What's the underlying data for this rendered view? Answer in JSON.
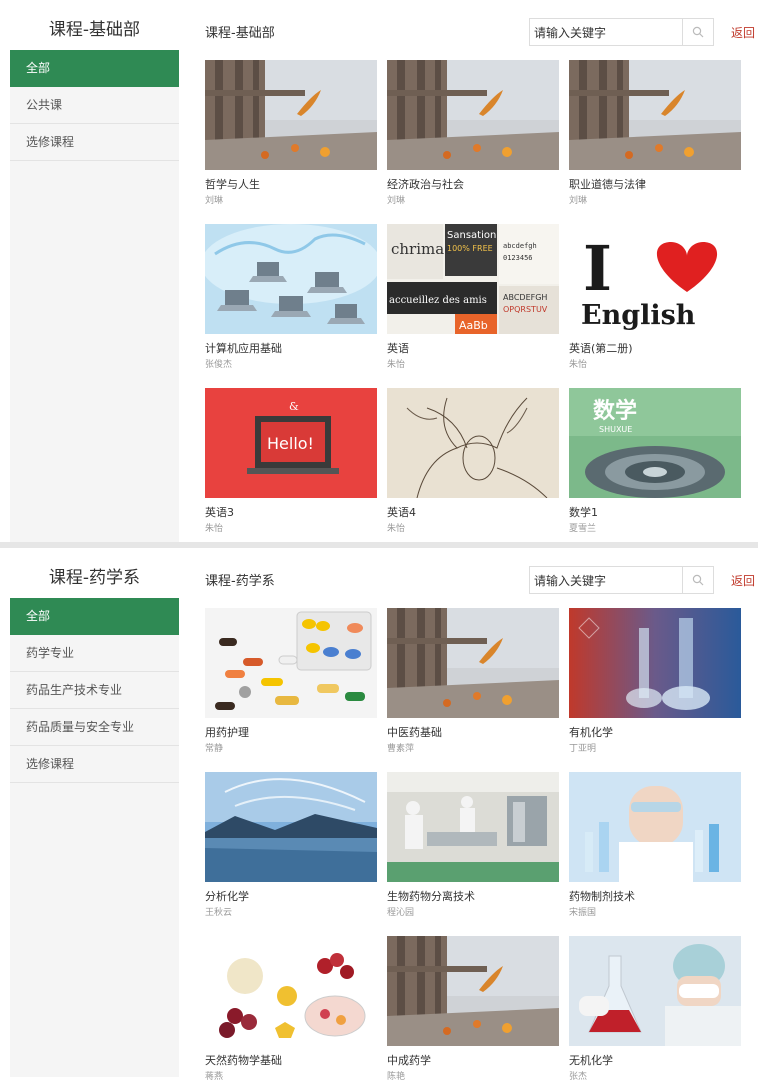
{
  "search_placeholder": "请输入关键字",
  "back_label": "返回",
  "panels": [
    {
      "title": "课程-基础部",
      "crumb": "课程-基础部",
      "menu": [
        "全部",
        "公共课",
        "选修课程"
      ],
      "courses": [
        {
          "title": "哲学与人生",
          "teacher": "刘琳",
          "image": "autumn-leaf-railing"
        },
        {
          "title": "经济政治与社会",
          "teacher": "刘琳",
          "image": "autumn-leaf-railing"
        },
        {
          "title": "职业道德与法律",
          "teacher": "刘琳",
          "image": "autumn-leaf-railing"
        },
        {
          "title": "计算机应用基础",
          "teacher": "张俊杰",
          "image": "network-laptops"
        },
        {
          "title": "英语",
          "teacher": "朱怡",
          "image": "typography-collage"
        },
        {
          "title": "英语(第二册)",
          "teacher": "朱怡",
          "image": "i-love-english"
        },
        {
          "title": "英语3",
          "teacher": "朱怡",
          "image": "hello-laptop"
        },
        {
          "title": "英语4",
          "teacher": "朱怡",
          "image": "deer-sketch"
        },
        {
          "title": "数学1",
          "teacher": "夏雪兰",
          "image": "math-book-cover"
        }
      ],
      "cover_text": {
        "love_i": "I",
        "love_word": "English",
        "hello": "Hello!",
        "hello_amp": "&",
        "math_cn": "数学",
        "math_en": "SHUXUE",
        "typo_1": "Sansation",
        "typo_2": "100% FREE",
        "typo_3": "chrimae",
        "typo_4": "accueillez des amis",
        "typo_5": "ABCDEFGH",
        "typo_6": "OPQRSTUV",
        "typo_7": "AaBb",
        "typo_8": "abcdefgh",
        "typo_9": "0123456"
      }
    },
    {
      "title": "课程-药学系",
      "crumb": "课程-药学系",
      "menu": [
        "全部",
        "药学专业",
        "药品生产技术专业",
        "药品质量与安全专业",
        "选修课程"
      ],
      "courses": [
        {
          "title": "用药护理",
          "teacher": "常静",
          "image": "pills-capsules"
        },
        {
          "title": "中医药基础",
          "teacher": "曹素萍",
          "image": "autumn-leaf-railing"
        },
        {
          "title": "有机化学",
          "teacher": "丁亚明",
          "image": "lab-glassware"
        },
        {
          "title": "分析化学",
          "teacher": "王秋云",
          "image": "lake-mountains"
        },
        {
          "title": "生物药物分离技术",
          "teacher": "程沁园",
          "image": "factory-workers"
        },
        {
          "title": "药物制剂技术",
          "teacher": "宋振国",
          "image": "scientist-test-tubes"
        },
        {
          "title": "天然药物学基础",
          "teacher": "蒋燕",
          "image": "fruits-bowl"
        },
        {
          "title": "中成药学",
          "teacher": "陈艳",
          "image": "autumn-leaf-railing"
        },
        {
          "title": "无机化学",
          "teacher": "张杰",
          "image": "chemist-flask"
        }
      ]
    }
  ],
  "colors": {
    "accent": "#2f8a54",
    "back": "#c0392b"
  }
}
